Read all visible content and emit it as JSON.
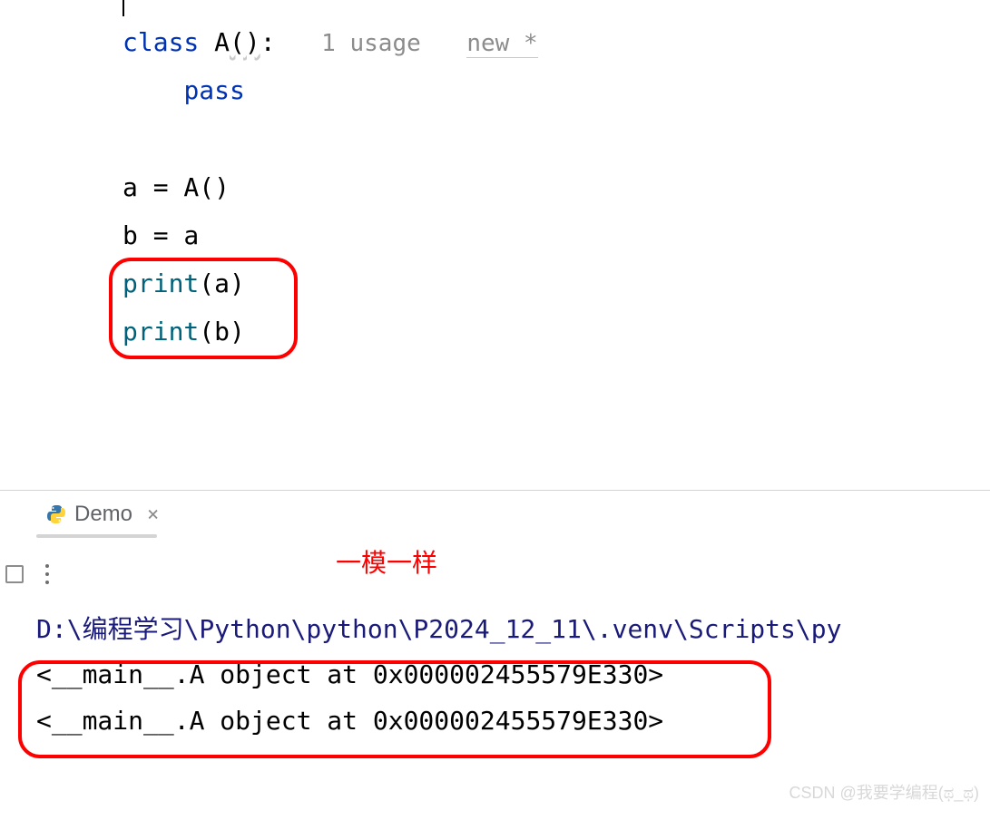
{
  "editor": {
    "line1": {
      "keyword": "class",
      "name": " A",
      "parens": "()",
      "colon": ":",
      "usage": "1 usage",
      "author": "new *"
    },
    "line2": {
      "indent": "    ",
      "keyword": "pass"
    },
    "line3": "",
    "line4": {
      "text": "a = A()"
    },
    "line5": {
      "text": "b = a"
    },
    "line6": {
      "func": "print",
      "args": "(a)"
    },
    "line7": {
      "func": "print",
      "args": "(b)"
    }
  },
  "tab": {
    "name": "Demo",
    "close": "×"
  },
  "annotation": "一模一样",
  "console": {
    "path": "D:\\编程学习\\Python\\python\\P2024_12_11\\.venv\\Scripts\\py",
    "output1": "<__main__.A object at 0x000002455579E330>",
    "output2": "<__main__.A object at 0x000002455579E330>"
  },
  "watermark": "CSDN @我要学编程(ಥ_ಥ)"
}
